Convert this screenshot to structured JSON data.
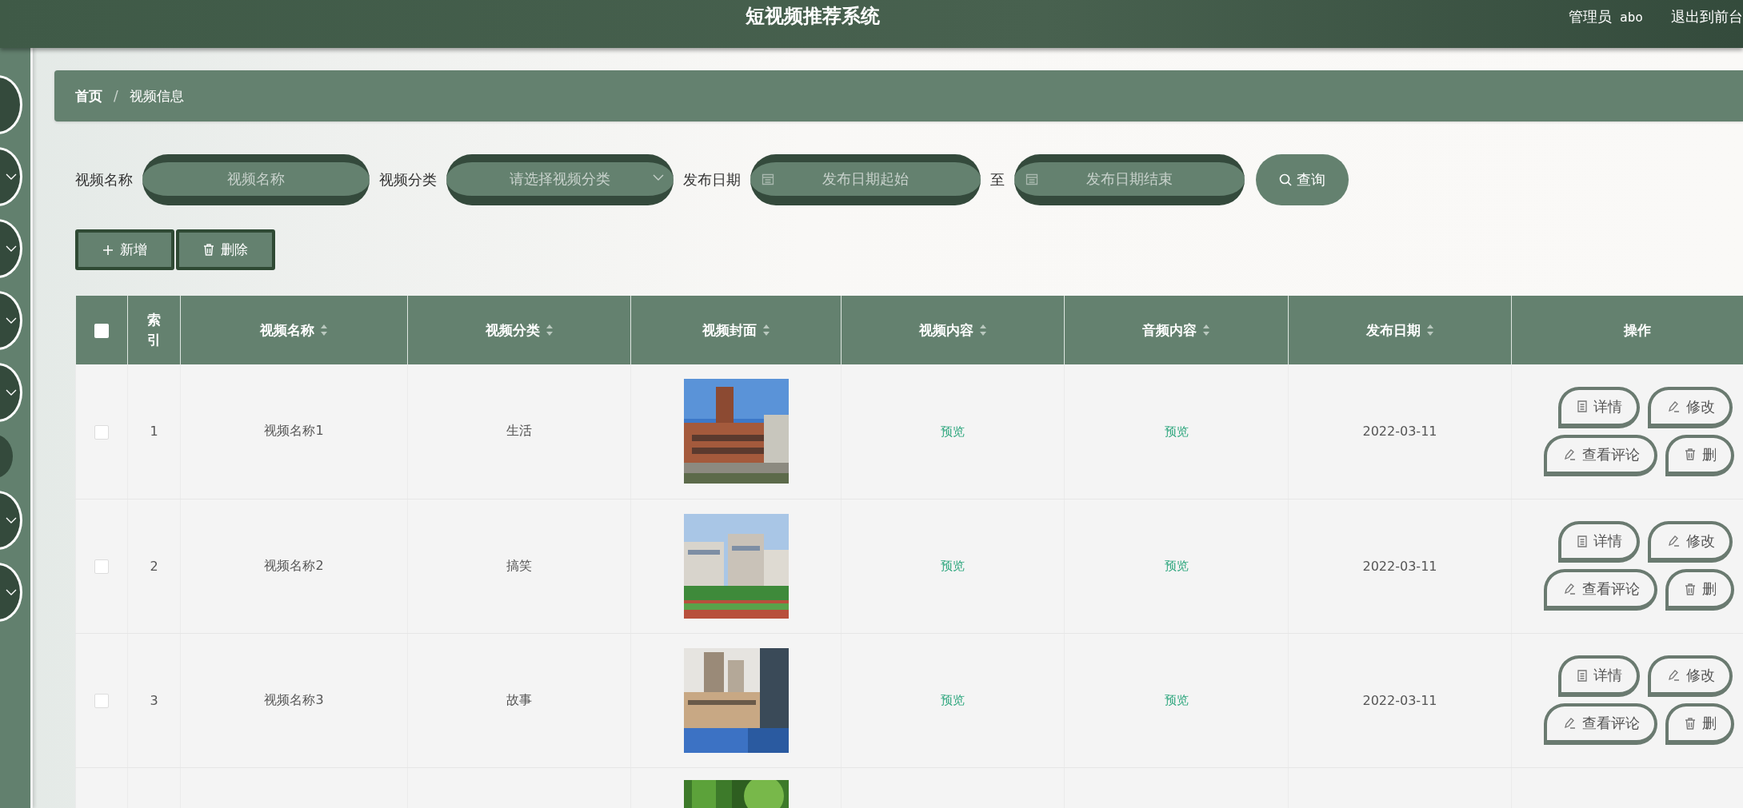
{
  "header": {
    "title": "短视频推荐系统",
    "user_role": "管理员",
    "user_name": "abo",
    "logout": "退出到前台"
  },
  "sidebar": {
    "items": [
      {
        "kind": "plain"
      },
      {
        "kind": "chevron"
      },
      {
        "kind": "chevron"
      },
      {
        "kind": "chevron"
      },
      {
        "kind": "chevron"
      },
      {
        "kind": "dot"
      },
      {
        "kind": "chevron"
      },
      {
        "kind": "chevron"
      }
    ]
  },
  "breadcrumb": {
    "items": [
      "首页",
      "视频信息"
    ],
    "separator": "/"
  },
  "filters": [
    {
      "kind": "text",
      "label": "视频名称",
      "placeholder": "视频名称"
    },
    {
      "kind": "select",
      "label": "视频分类",
      "placeholder": "请选择视频分类"
    },
    {
      "kind": "daterange",
      "label": "发布日期",
      "start_placeholder": "发布日期起始",
      "joiner": "至",
      "end_placeholder": "发布日期结束"
    }
  ],
  "search_button": "查询",
  "actions": [
    {
      "label": "新增",
      "kind": "plus"
    },
    {
      "label": "删除",
      "kind": "trash"
    }
  ],
  "table": {
    "columns": [
      {
        "kind": "checkbox",
        "checked": false
      },
      {
        "kind": "text",
        "label": "索引",
        "sortable": false
      },
      {
        "kind": "text",
        "label": "视频名称",
        "sortable": true
      },
      {
        "kind": "text",
        "label": "视频分类",
        "sortable": true
      },
      {
        "kind": "text",
        "label": "视频封面",
        "sortable": true
      },
      {
        "kind": "text",
        "label": "视频内容",
        "sortable": true
      },
      {
        "kind": "text",
        "label": "音频内容",
        "sortable": true
      },
      {
        "kind": "text",
        "label": "发布日期",
        "sortable": true
      },
      {
        "kind": "text",
        "label": "操作",
        "sortable": false
      }
    ],
    "rows": [
      {
        "checked": false,
        "index": "1",
        "name": "视频名称1",
        "category": "生活",
        "cover": {
          "kind": "picture"
        },
        "video": "预览",
        "audio": "预览",
        "date": "2022-03-11",
        "actions": [
          {
            "label": "详情",
            "kind": "doc"
          },
          {
            "label": "修改",
            "kind": "pencil"
          },
          {
            "label": "查看评论",
            "kind": "pencil"
          },
          {
            "label": "删",
            "kind": "trash"
          }
        ]
      },
      {
        "checked": false,
        "index": "2",
        "name": "视频名称2",
        "category": "搞笑",
        "cover": {
          "kind": "picture"
        },
        "video": "预览",
        "audio": "预览",
        "date": "2022-03-11",
        "actions": [
          {
            "label": "详情",
            "kind": "doc"
          },
          {
            "label": "修改",
            "kind": "pencil"
          },
          {
            "label": "查看评论",
            "kind": "pencil"
          },
          {
            "label": "删",
            "kind": "trash"
          }
        ]
      },
      {
        "checked": false,
        "index": "3",
        "name": "视频名称3",
        "category": "故事",
        "cover": {
          "kind": "picture"
        },
        "video": "预览",
        "audio": "预览",
        "date": "2022-03-11",
        "actions": [
          {
            "label": "详情",
            "kind": "doc"
          },
          {
            "label": "修改",
            "kind": "pencil"
          },
          {
            "label": "查看评论",
            "kind": "pencil"
          },
          {
            "label": "删",
            "kind": "trash"
          }
        ]
      },
      {
        "cover": {
          "kind": "picture"
        }
      }
    ]
  }
}
